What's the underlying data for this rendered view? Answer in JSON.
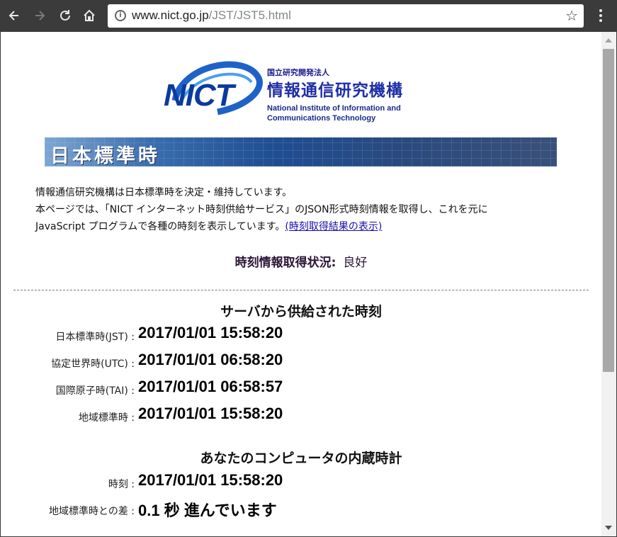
{
  "browser": {
    "url_host": "www.nict.go.jp",
    "url_path": "/JST/JST5.html",
    "nav": {
      "back_icon": "arrow-left-icon",
      "forward_icon": "arrow-right-icon",
      "reload_icon": "reload-icon",
      "home_icon": "home-icon"
    }
  },
  "logo": {
    "mark": "NICT",
    "org_small": "国立研究開発法人",
    "org_big": "情報通信研究機構",
    "org_en_line1": "National Institute of Information and",
    "org_en_line2": "Communications Technology"
  },
  "banner": {
    "title": "日本標準時"
  },
  "intro": {
    "line1": "情報通信研究機構は日本標準時を決定・維持しています。",
    "line2": "本ページでは、「NICT インターネット時刻供給サービス」のJSON形式時刻情報を取得し、これを元に",
    "line3": "JavaScript プログラムで各種の時刻を表示しています。",
    "link": "(時刻取得結果の表示)"
  },
  "status": {
    "label": "時刻情報取得状況:",
    "value": "良好"
  },
  "server": {
    "title": "サーバから供給された時刻",
    "rows": [
      {
        "label": "日本標準時(JST) :",
        "value": "2017/01/01 15:58:20"
      },
      {
        "label": "協定世界時(UTC) :",
        "value": "2017/01/01 06:58:20"
      },
      {
        "label": "国際原子時(TAI) :",
        "value": "2017/01/01 06:58:57"
      },
      {
        "label": "地域標準時 :",
        "value": "2017/01/01 15:58:20"
      }
    ]
  },
  "local": {
    "title": "あなたのコンピュータの内蔵時計",
    "rows": [
      {
        "label": "時刻 :",
        "value": "2017/01/01 15:58:20"
      },
      {
        "label": "地域標準時との差 :",
        "value": "0.1 秒 進んでいます"
      }
    ]
  }
}
